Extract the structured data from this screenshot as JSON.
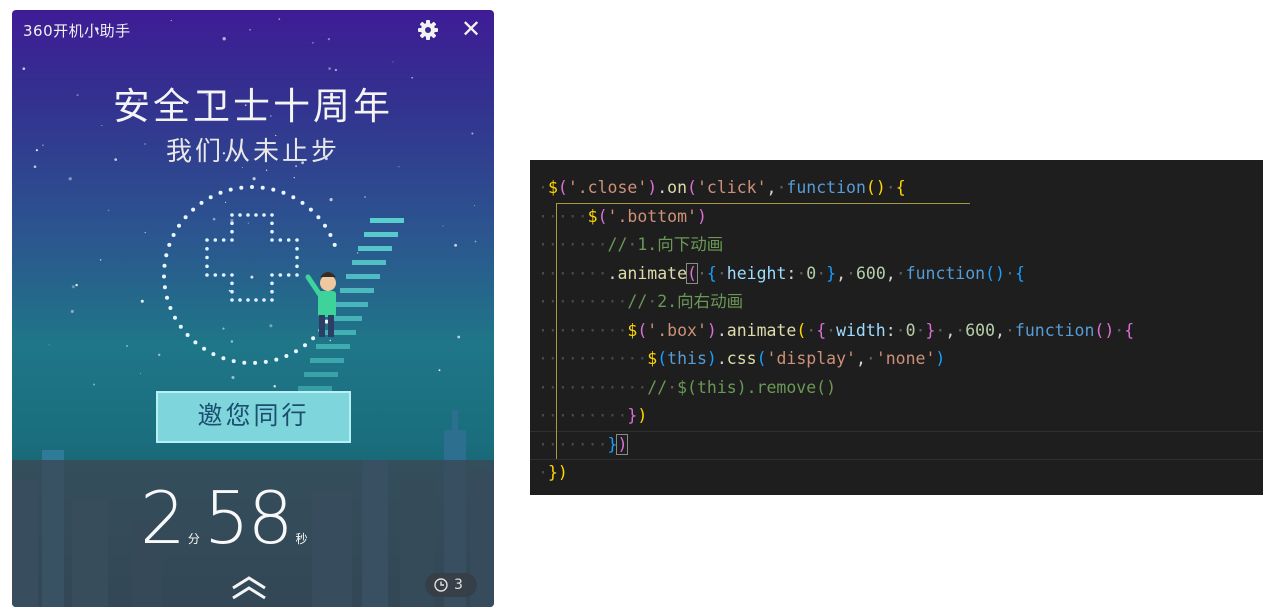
{
  "widget": {
    "title": "360开机小助手",
    "headline": "安全卫士十周年",
    "subline": "我们从未止步",
    "invite_button": "邀您同行",
    "timer": {
      "minutes": "2",
      "minute_unit": "分",
      "seconds": "58",
      "second_unit": "秒"
    },
    "clock_count": "3",
    "icons": [
      "gear-icon",
      "close-icon",
      "chevron-up-icon",
      "clock-icon"
    ],
    "colors": {
      "accent_button": "#7ed6dc",
      "bg_top": "#3f1c96",
      "bg_bottom": "#144a5a"
    }
  },
  "editor": {
    "lines": [
      {
        "indent": "·",
        "tokens": [
          {
            "t": "$",
            "c": "y"
          },
          {
            "t": "(",
            "c": "p"
          },
          {
            "t": "'.close'",
            "c": "s"
          },
          {
            "t": ")",
            "c": "p"
          },
          {
            "t": ".",
            "c": "t"
          },
          {
            "t": "on",
            "c": "f"
          },
          {
            "t": "(",
            "c": "p"
          },
          {
            "t": "'click'",
            "c": "s"
          },
          {
            "t": ",",
            "c": "t"
          },
          {
            "t": "·",
            "c": "g"
          },
          {
            "t": "function",
            "c": "k"
          },
          {
            "t": "()",
            "c": "y"
          },
          {
            "t": "·",
            "c": "g"
          },
          {
            "t": "{",
            "c": "y"
          }
        ]
      },
      {
        "indent": "·····",
        "tokens": [
          {
            "t": "$",
            "c": "y"
          },
          {
            "t": "(",
            "c": "p"
          },
          {
            "t": "'.bottom'",
            "c": "s"
          },
          {
            "t": ")",
            "c": "p"
          }
        ]
      },
      {
        "indent": "·······",
        "tokens": [
          {
            "t": "//",
            "c": "c"
          },
          {
            "t": "·",
            "c": "g"
          },
          {
            "t": "1.向下动画",
            "c": "c"
          }
        ]
      },
      {
        "indent": "·······",
        "tokens": [
          {
            "t": ".",
            "c": "t"
          },
          {
            "t": "animate",
            "c": "f"
          },
          {
            "t": "(",
            "c": "p",
            "hl": true
          },
          {
            "t": "·",
            "c": "g"
          },
          {
            "t": "{",
            "c": "b"
          },
          {
            "t": "·",
            "c": "g"
          },
          {
            "t": "height",
            "c": "v"
          },
          {
            "t": ":",
            "c": "t"
          },
          {
            "t": "·",
            "c": "g"
          },
          {
            "t": "0",
            "c": "n"
          },
          {
            "t": "·",
            "c": "g"
          },
          {
            "t": "}",
            "c": "b"
          },
          {
            "t": ",",
            "c": "t"
          },
          {
            "t": "·",
            "c": "g"
          },
          {
            "t": "600",
            "c": "n"
          },
          {
            "t": ",",
            "c": "t"
          },
          {
            "t": "·",
            "c": "g"
          },
          {
            "t": "function",
            "c": "k"
          },
          {
            "t": "()",
            "c": "b"
          },
          {
            "t": "·",
            "c": "g"
          },
          {
            "t": "{",
            "c": "b"
          }
        ]
      },
      {
        "indent": "·········",
        "tokens": [
          {
            "t": "//",
            "c": "c"
          },
          {
            "t": "·",
            "c": "g"
          },
          {
            "t": "2.向右动画",
            "c": "c"
          }
        ]
      },
      {
        "indent": "·········",
        "tokens": [
          {
            "t": "$",
            "c": "y"
          },
          {
            "t": "(",
            "c": "p"
          },
          {
            "t": "'.box'",
            "c": "s"
          },
          {
            "t": ")",
            "c": "p"
          },
          {
            "t": ".",
            "c": "t"
          },
          {
            "t": "animate",
            "c": "f"
          },
          {
            "t": "(",
            "c": "y"
          },
          {
            "t": "·",
            "c": "g"
          },
          {
            "t": "{",
            "c": "p"
          },
          {
            "t": "·",
            "c": "g"
          },
          {
            "t": "width",
            "c": "v"
          },
          {
            "t": ":",
            "c": "t"
          },
          {
            "t": "·",
            "c": "g"
          },
          {
            "t": "0",
            "c": "n"
          },
          {
            "t": "·",
            "c": "g"
          },
          {
            "t": "}",
            "c": "p"
          },
          {
            "t": "·",
            "c": "g"
          },
          {
            "t": ",",
            "c": "t"
          },
          {
            "t": "·",
            "c": "g"
          },
          {
            "t": "600",
            "c": "n"
          },
          {
            "t": ",",
            "c": "t"
          },
          {
            "t": "·",
            "c": "g"
          },
          {
            "t": "function",
            "c": "k"
          },
          {
            "t": "()",
            "c": "p"
          },
          {
            "t": "·",
            "c": "g"
          },
          {
            "t": "{",
            "c": "p"
          }
        ]
      },
      {
        "indent": "···········",
        "tokens": [
          {
            "t": "$",
            "c": "y"
          },
          {
            "t": "(",
            "c": "b"
          },
          {
            "t": "this",
            "c": "k"
          },
          {
            "t": ")",
            "c": "b"
          },
          {
            "t": ".",
            "c": "t"
          },
          {
            "t": "css",
            "c": "f"
          },
          {
            "t": "(",
            "c": "b"
          },
          {
            "t": "'display'",
            "c": "s"
          },
          {
            "t": ",",
            "c": "t"
          },
          {
            "t": "·",
            "c": "g"
          },
          {
            "t": "'none'",
            "c": "s"
          },
          {
            "t": ")",
            "c": "b"
          }
        ]
      },
      {
        "indent": "···········",
        "tokens": [
          {
            "t": "//",
            "c": "c"
          },
          {
            "t": "·",
            "c": "g"
          },
          {
            "t": "$(this).remove()",
            "c": "c"
          }
        ]
      },
      {
        "indent": "·········",
        "tokens": [
          {
            "t": "}",
            "c": "p"
          },
          {
            "t": ")",
            "c": "y"
          }
        ]
      },
      {
        "indent": "·······",
        "tokens": [
          {
            "t": "}",
            "c": "b"
          },
          {
            "t": ")",
            "c": "p",
            "hl": true
          }
        ]
      },
      {
        "indent": "·",
        "tokens": [
          {
            "t": "})",
            "c": "y"
          }
        ]
      }
    ]
  }
}
